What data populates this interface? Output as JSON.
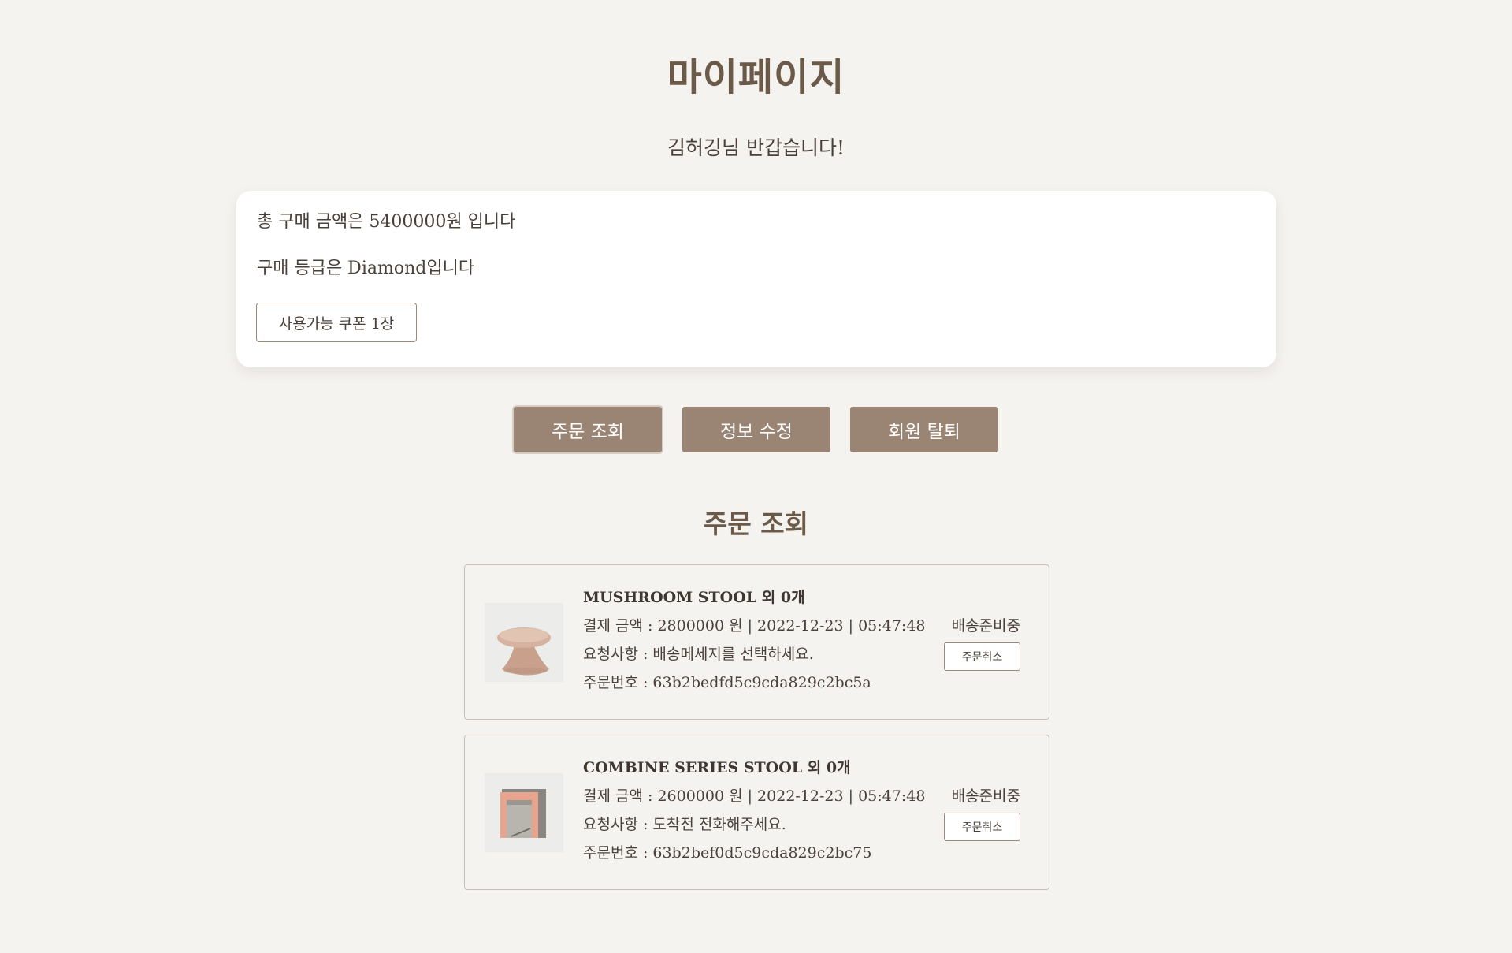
{
  "page": {
    "title": "마이페이지",
    "greeting": "김허깅님 반갑습니다!"
  },
  "summary": {
    "total_text": "총 구매 금액은 5400000원 입니다",
    "grade_text": "구매 등급은 Diamond입니다",
    "coupon_label": "사용가능 쿠폰 1장"
  },
  "tabs": [
    {
      "label": "주문 조회",
      "active": true
    },
    {
      "label": "정보 수정",
      "active": false
    },
    {
      "label": "회원 탈퇴",
      "active": false
    }
  ],
  "orders_section": {
    "title": "주문 조회"
  },
  "orders": [
    {
      "name": "MUSHROOM STOOL 외 0개",
      "amount_line": "결제 금액 : 2800000 원 | 2022-12-23 | 05:47:48",
      "request_line": "요청사항 : 배송메세지를 선택하세요.",
      "number_line": "주문번호 : 63b2bedfd5c9cda829c2bc5a",
      "status": "배송준비중",
      "cancel_label": "주문취소",
      "thumbnail_icon": "mushroom-stool-image"
    },
    {
      "name": "COMBINE SERIES STOOL 외 0개",
      "amount_line": "결제 금액 : 2600000 원 | 2022-12-23 | 05:47:48",
      "request_line": "요청사항 : 도착전 전화해주세요.",
      "number_line": "주문번호 : 63b2bef0d5c9cda829c2bc75",
      "status": "배송준비중",
      "cancel_label": "주문취소",
      "thumbnail_icon": "combine-stool-image"
    }
  ],
  "colors": {
    "background": "#f5f3f0",
    "accent_button": "#9a8575",
    "title_text": "#6b5a48",
    "card_background": "#ffffff"
  }
}
